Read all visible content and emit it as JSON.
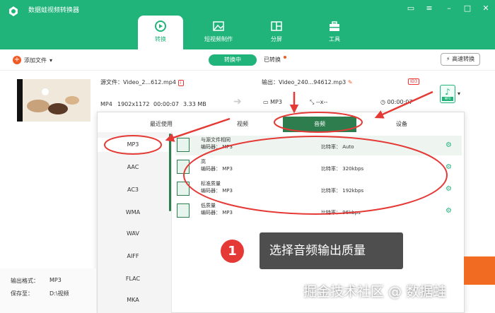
{
  "window": {
    "title": "数据蛙视频转换器"
  },
  "main_tabs": [
    {
      "label": "转换"
    },
    {
      "label": "短视频制作"
    },
    {
      "label": "分屏"
    },
    {
      "label": "工具"
    }
  ],
  "toolbar": {
    "add_file": "添加文件",
    "converting": "转换中",
    "converted": "已转换",
    "fast_convert": "高速转换"
  },
  "file": {
    "source": "源文件：Video_2...612.mp4",
    "format": "MP4",
    "resolution": "1902x1172",
    "duration": "00:00:07",
    "size": "3.33 MB",
    "output": "输出：Video_240...94612.mp3",
    "out_format": "MP3",
    "out_res": "--x--",
    "out_duration": "00:00:07",
    "out_icon_tag": "MP3"
  },
  "panel": {
    "tabs": [
      "最近使用",
      "视频",
      "音频",
      "设备"
    ],
    "formats": [
      "MP3",
      "AAC",
      "AC3",
      "WMA",
      "WAV",
      "AIFF",
      "FLAC",
      "MKA"
    ],
    "qualities": [
      {
        "name": "与源文件相同",
        "encoder_label": "编码器：",
        "encoder": "MP3",
        "bitrate_label": "比特率：",
        "bitrate": "Auto"
      },
      {
        "name": "高",
        "encoder_label": "编码器：",
        "encoder": "MP3",
        "bitrate_label": "比特率：",
        "bitrate": "320kbps"
      },
      {
        "name": "标准质量",
        "encoder_label": "编码器：",
        "encoder": "MP3",
        "bitrate_label": "比特率：",
        "bitrate": "192kbps"
      },
      {
        "name": "低质量",
        "encoder_label": "编码器：",
        "encoder": "MP3",
        "bitrate_label": "比特率：",
        "bitrate": "96kbps"
      }
    ]
  },
  "callout": {
    "number": "1",
    "text": "选择音频输出质量"
  },
  "bottom": {
    "output_format_label": "输出格式：",
    "output_format": "MP3",
    "save_to_label": "保存至：",
    "save_to": "D:\\视频"
  },
  "watermark": "掘金技术社区 @ 数据蛙",
  "colors": {
    "brand": "#20b37a",
    "dark_green": "#2e7d4f",
    "accent_red": "#e53935",
    "orange": "#f26b22"
  }
}
